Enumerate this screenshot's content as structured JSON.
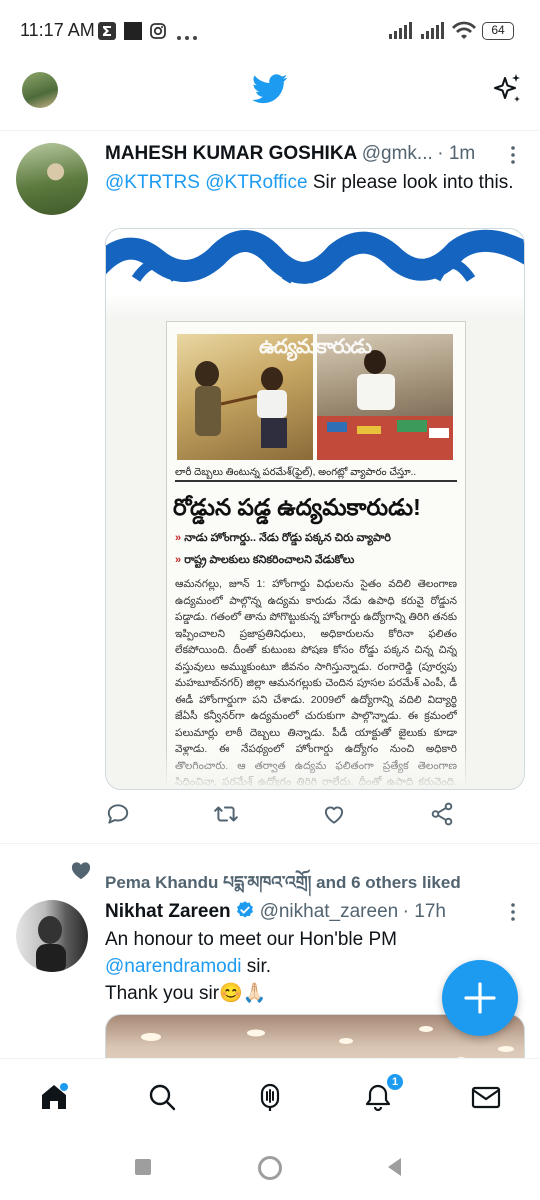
{
  "status_bar": {
    "time": "11:17 AM",
    "battery": "64"
  },
  "tweets": [
    {
      "name": "MAHESH KUMAR GOSHIKA",
      "handle": "@gmk...",
      "time": "· 1m",
      "mention1": "@KTRTRS",
      "mention2": "@KTRoffice",
      "text": " Sir please look into this.",
      "newspaper": {
        "caption": "లారీ దెబ్బలు తింటున్న పరమేశ్(ఫైల్), అంగట్లో వ్యాపారం చేస్తూ..",
        "headline": "రోడ్డున పడ్డ ఉద్యమకారుడు!",
        "sub1": "నాడు హోంగార్డు.. నేడు రోడ్డు పక్కన చిరు వ్యాపారి",
        "sub2": "రాష్ట్ర పాలకులు కనికరించాలని వేడుకోలు",
        "body": "ఆమనగల్లు, జూన్ 1: హోంగార్డు విధులను సైతం వదిలి తెలంగాణ ఉద్యమంలో పాల్గొన్న ఉద్యమ కారుడు నేడు ఉపాధి కరువై రోడ్డున పడ్డాడు. గతంలో తాను పోగొట్టుకున్న హోంగార్డు ఉద్యోగాన్ని తిరిగి తనకు ఇప్పించాలని ప్రజాప్రతినిధులు, అధికారులను కోరినా ఫలితం లేకపోయింది. దీంతో కుటుంబ పోషణ కోసం రోడ్డు పక్కన చిన్న చిన్న వస్తువులు అమ్ముకుంటూ జీవనం సాగిస్తున్నాడు. రంగారెడ్డి (పూర్వపు మహబూబ్‌నగర్) జిల్లా ఆమనగల్లుకు చెందిన పూసల పరమేశ్ ఎంపీ, డీ ఈడీ హోంగార్డుగా పని చేశాడు. 2009లో ఉద్యోగాన్ని వదిలి విద్యార్థి జేఏసీ కన్వీనర్‌గా ఉద్యమంలో చురుకుగా పాల్గొన్నాడు. ఈ క్రమంలో పలుమార్లు లాఠీ దెబ్బలు తిన్నాడు. పీడీ యాక్టుతో జైలుకు కూడా వెళ్లాడు. ఈ నేపథ్యంలో హోంగార్డు ఉద్యోగం నుంచి అధికారి తొలగించారు. ఆ తర్వాత ఉద్యమ ఫలితంగా ప్రత్యేక తెలంగాణ సిద్ధించినా, పరమేశ్ ఉద్యోగం తిరిగి రాలేదు. దీంతో ఉపాధి కరువైంది. కుటుంబ పోషణ కోసం రోడ్డు పక్కన చిన్న చిన్న వస్తువులు విక్రయిస్తూ జీవనం సాగిస్తున్నాడు. తెలంగాణ ఏర్పాటైన నాటి నుంచి ఉద్యమకారులు"
      }
    },
    {
      "social_context": "Pema Khandu པདྨ་མཁའ་འགྲོ། and 6 others liked",
      "name": "Nikhat Zareen",
      "handle": "@nikhat_zareen",
      "time": "· 17h",
      "line1": "An honour to meet our Hon'ble PM",
      "mention": "@narendramodi",
      "line2_rest": " sir.",
      "line3": "Thank you sir😊🙏🏻"
    }
  ],
  "nav": {
    "notifications_badge": "1"
  },
  "colors": {
    "accent": "#1d9bf0",
    "text": "#0f1419",
    "muted": "#536471"
  }
}
